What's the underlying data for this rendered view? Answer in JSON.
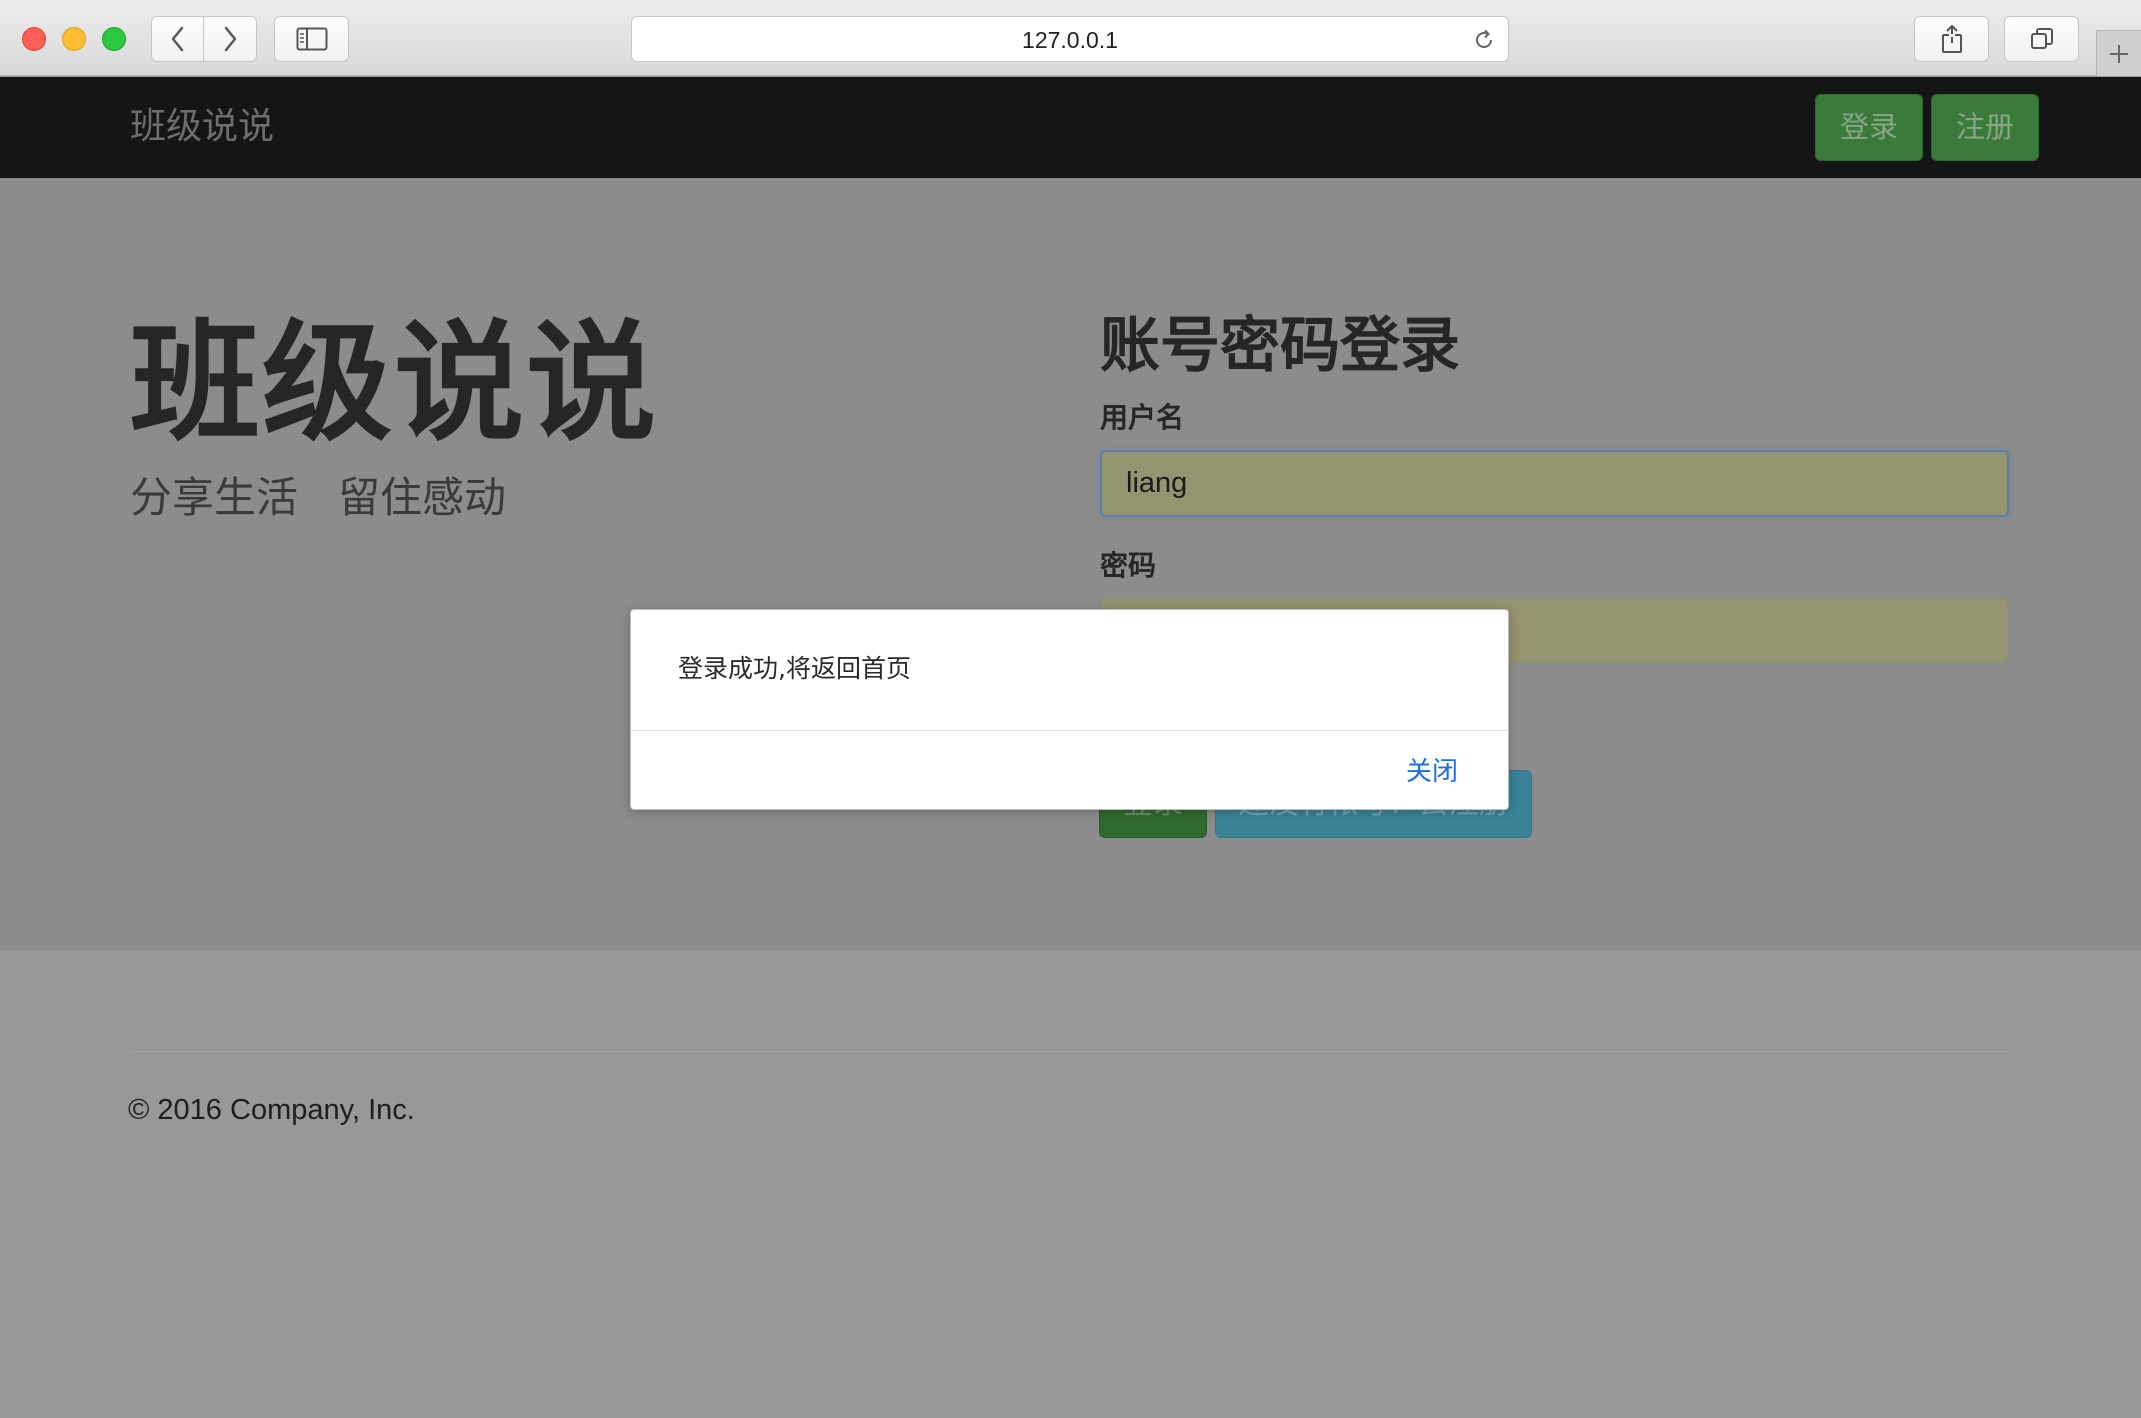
{
  "browser": {
    "url": "127.0.0.1",
    "icons": {
      "back": "chevron-left-icon",
      "forward": "chevron-right-icon",
      "sidebar": "sidebar-icon",
      "reload": "reload-icon",
      "share": "share-icon",
      "tabs": "tabs-icon",
      "new_tab": "plus-icon"
    }
  },
  "navbar": {
    "brand": "班级说说",
    "login_label": "登录",
    "register_label": "注册"
  },
  "hero": {
    "title": "班级说说",
    "subtitle": "分享生活   留住感动"
  },
  "login_form": {
    "title": "账号密码登录",
    "username_label": "用户名",
    "username_value": "liang",
    "password_label": "密码",
    "password_value": "",
    "submit_label": "登录",
    "register_link_label": "还没有帐号？去注册"
  },
  "footer": {
    "copyright": "© 2016 Company, Inc."
  },
  "alert": {
    "message": "登录成功,将返回首页",
    "close_label": "关闭"
  },
  "colors": {
    "navbar_bg": "#151515",
    "success_button": "#3a7a3a",
    "info_button": "#3a8397",
    "link_blue": "#1a6fe0",
    "autofill_input": "#949470"
  }
}
